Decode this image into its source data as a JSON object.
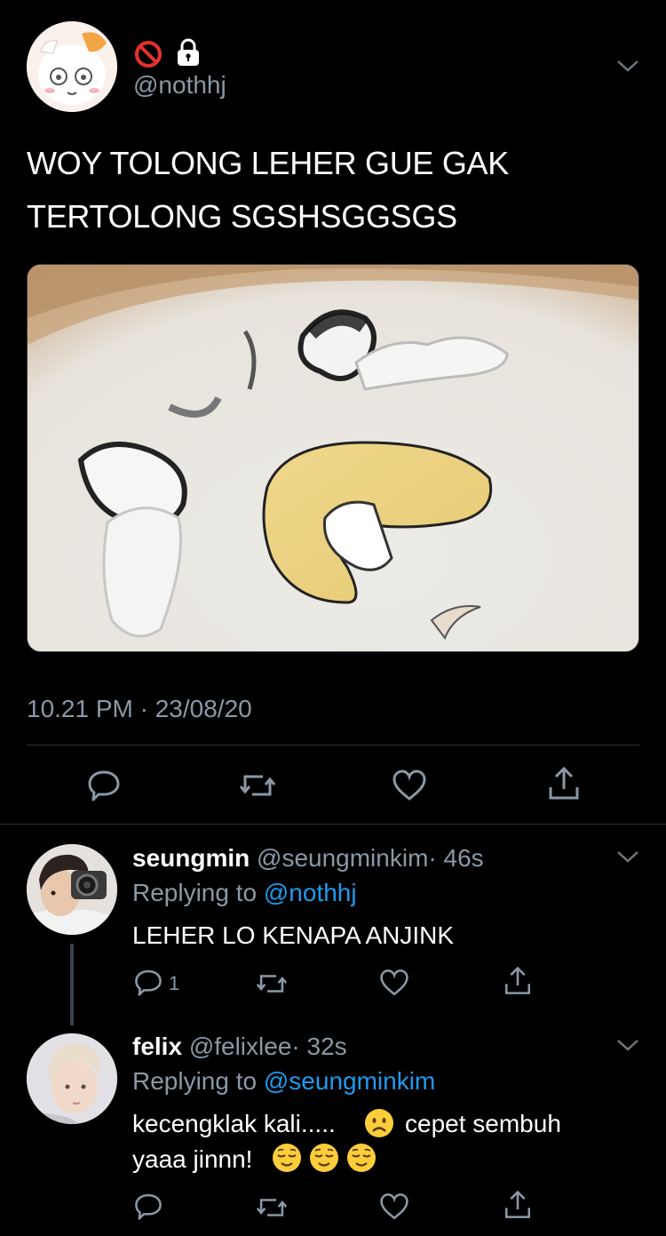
{
  "main_tweet": {
    "handle": "@nothhj",
    "text_line1": "WOY TOLONG LEHER GUE GAK",
    "text_line2": "TERTOLONG SGSHSGGSGS",
    "timestamp": "10.21 PM · 23/08/20",
    "badges": [
      "no-entry-icon",
      "lock-icon"
    ]
  },
  "replies": [
    {
      "name": "seungmin",
      "handle": "@seungminkim",
      "time": "· 46s",
      "replying_label": "Replying to",
      "replying_to": "@nothhj",
      "text": "LEHER LO KENAPA ANJINK",
      "reply_count": "1"
    },
    {
      "name": "felix",
      "handle": "@felixlee",
      "time": "· 32s",
      "replying_label": "Replying to",
      "replying_to": "@seungminkim",
      "text_a": "kecengklak kali.....",
      "text_b": "cepet sembuh",
      "text_c": "yaaa jinnn!"
    }
  ],
  "colors": {
    "background": "#000000",
    "muted": "#8b98a5",
    "link": "#1d9bf0",
    "divider": "#2f3336"
  }
}
